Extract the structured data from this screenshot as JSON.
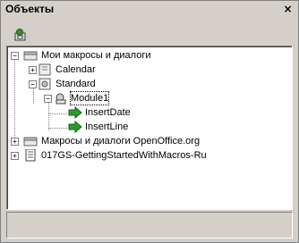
{
  "window": {
    "title": "Объекты",
    "close_label": "×"
  },
  "toolbar": {
    "macro_icon": "macro-organizer-icon"
  },
  "tree": {
    "root": "Мои макросы и диалоги",
    "library_calendar": "Calendar",
    "library_standard": "Standard",
    "module": "Module1",
    "macro_1": "InsertDate",
    "macro_2": "InsertLine",
    "org_macros": "Макросы и диалоги OpenOffice.org",
    "document": "017GS-GettingStartedWithMacros-Ru"
  }
}
